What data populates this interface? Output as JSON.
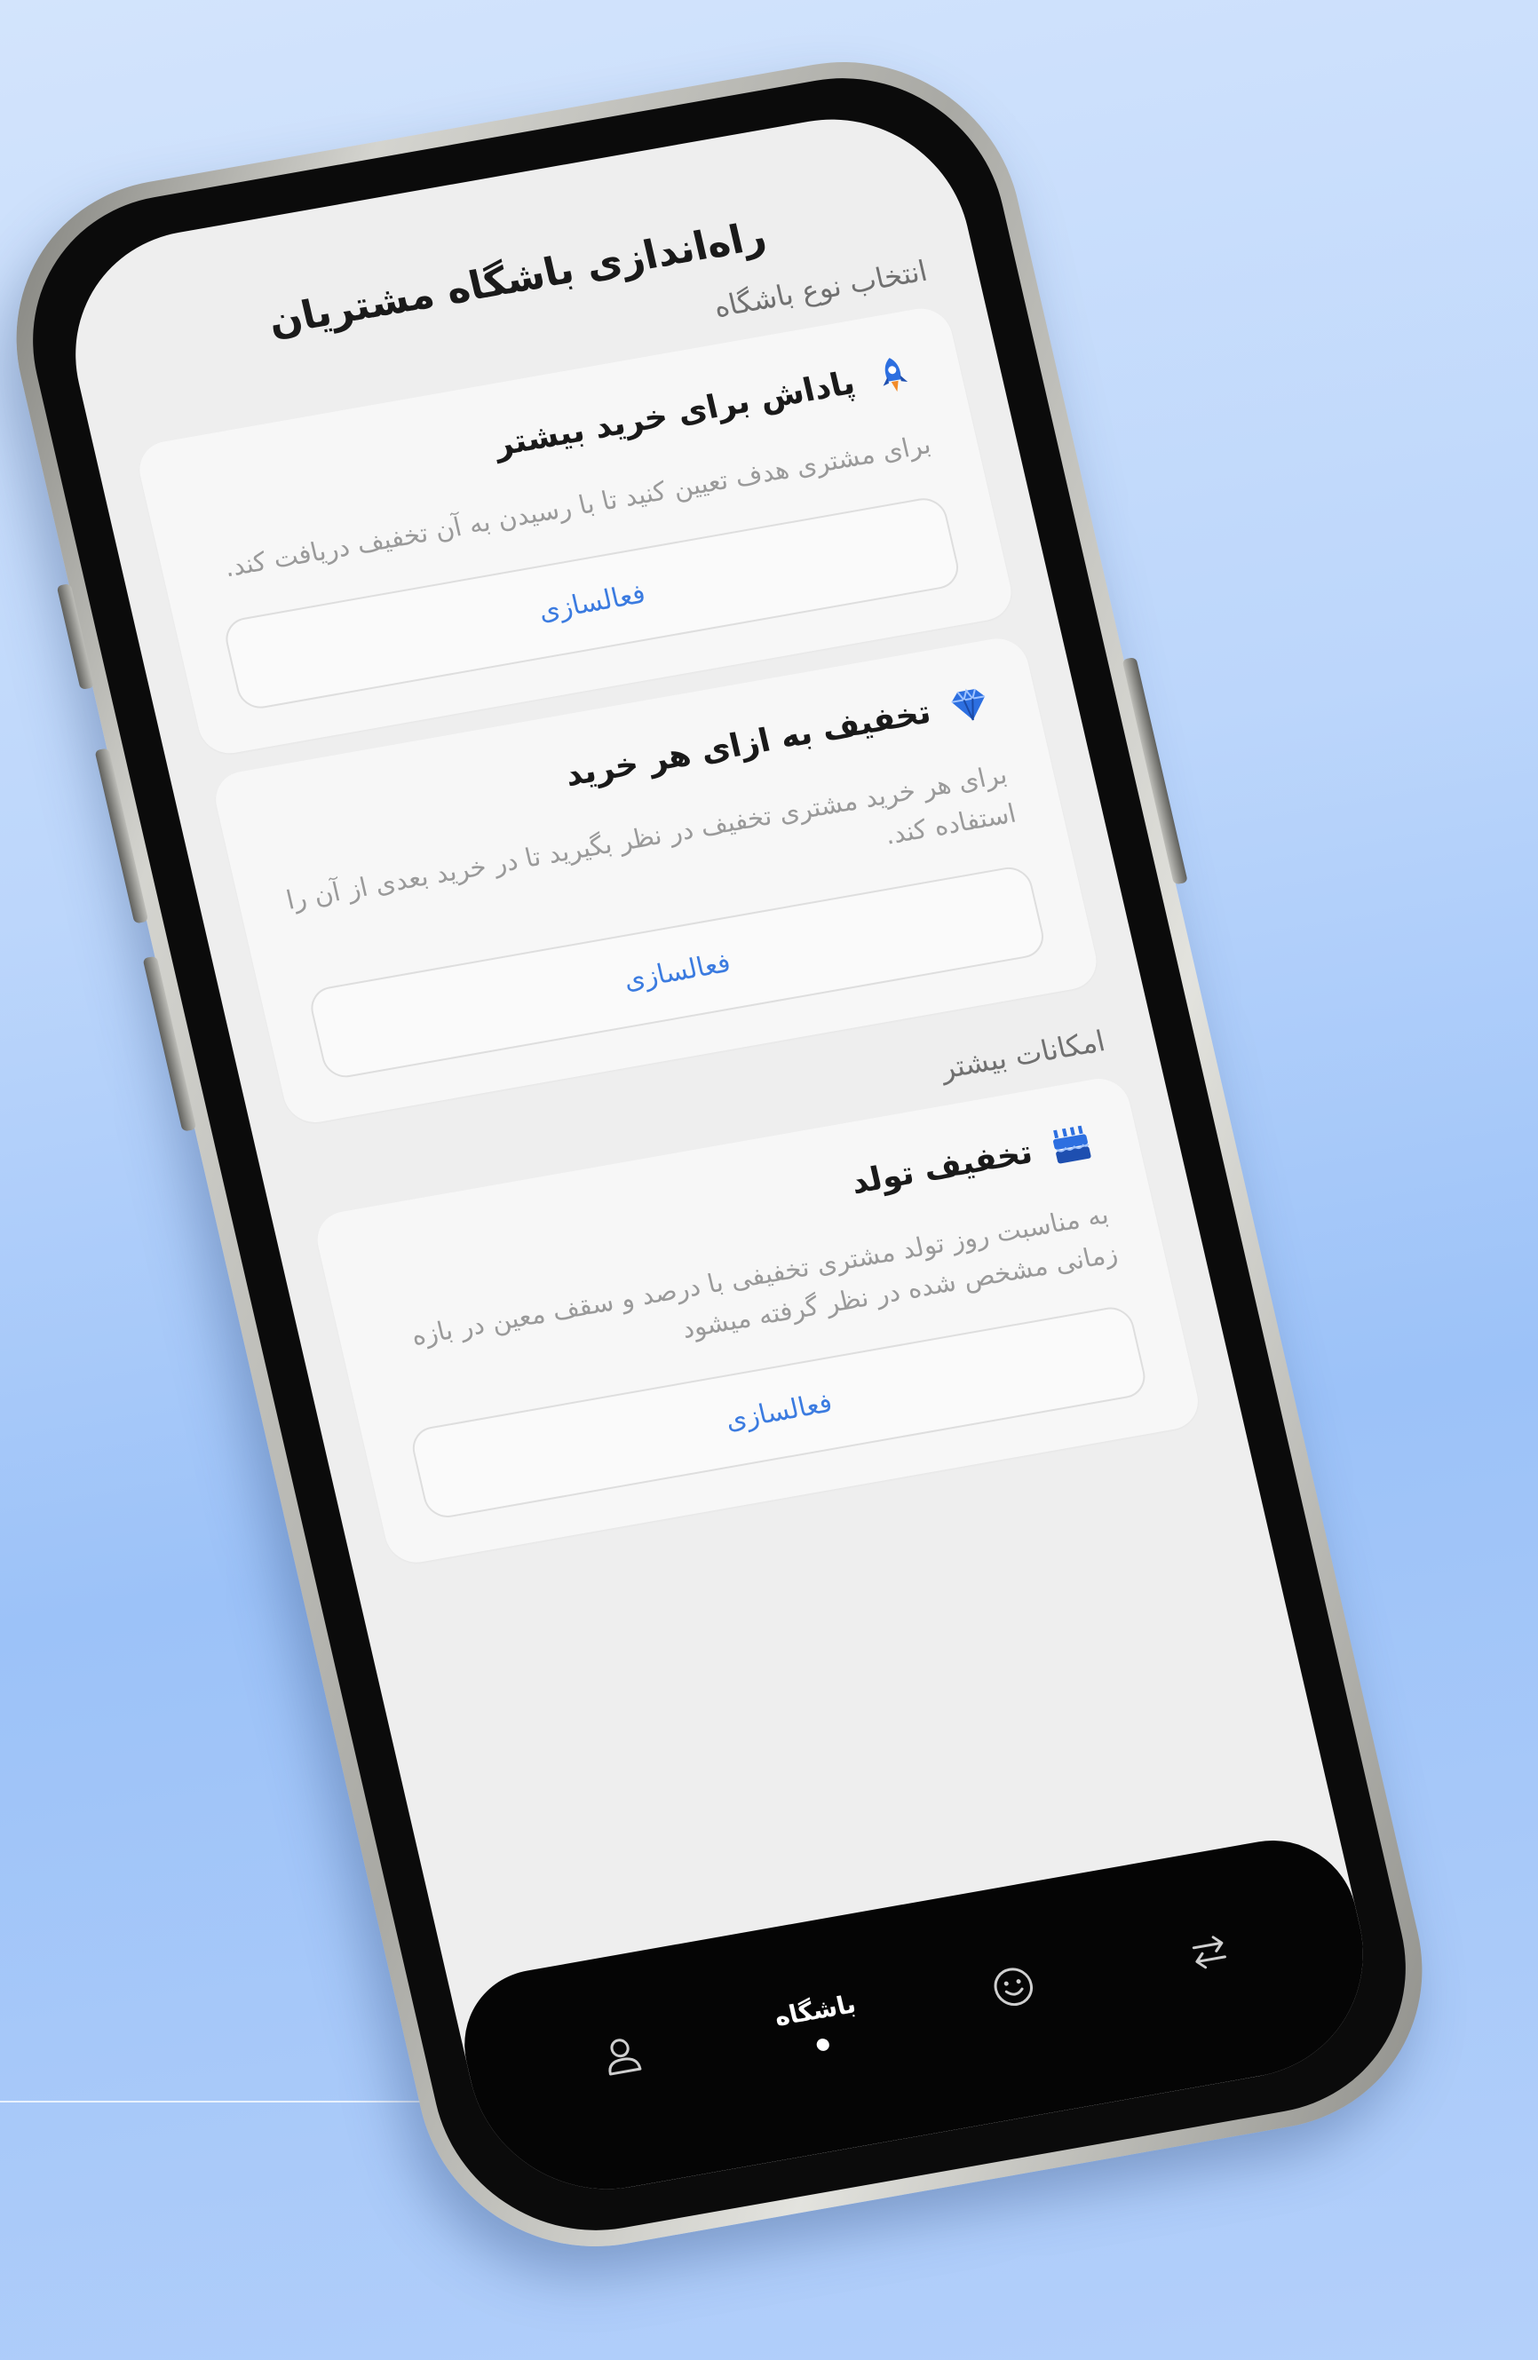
{
  "header": {
    "title": "راه‌اندازی باشگاه مشتریان"
  },
  "sections": {
    "club_type_label": "انتخاب نوع باشگاه",
    "more_features_label": "امکانات بیشتر"
  },
  "cards": [
    {
      "title": "پاداش برای خرید بیشتر",
      "icon": "rocket-icon",
      "description": "برای مشتری هدف تعیین کنید تا با رسیدن به آن تخفیف دریافت کند.",
      "button_label": "فعالسازی"
    },
    {
      "title": "تخفیف به ازای هر خرید",
      "icon": "diamond-icon",
      "description": "برای هر خرید مشتری تخفیف در نظر بگیرید تا در خرید بعدی از آن را استفاده کند.",
      "button_label": "فعالسازی"
    },
    {
      "title": "تخفیف تولد",
      "icon": "birthday-cake-icon",
      "description": "به مناسبت روز تولد مشتری تخفیفی با درصد و سقف معین در بازه زمانی مشخص شده در نظر گرفته میشود",
      "button_label": "فعالسازی"
    }
  ],
  "bottom_nav": {
    "items": [
      {
        "icon": "transfer-icon",
        "label": ""
      },
      {
        "icon": "smiley-icon",
        "label": ""
      },
      {
        "icon": "club-icon",
        "label": "باشگاه",
        "active": true
      },
      {
        "icon": "user-icon",
        "label": ""
      }
    ]
  },
  "colors": {
    "accent": "#3b7be0",
    "screen_bg": "#eeeeee",
    "card_bg": "#f7f7f7",
    "nav_bg": "#050505"
  }
}
